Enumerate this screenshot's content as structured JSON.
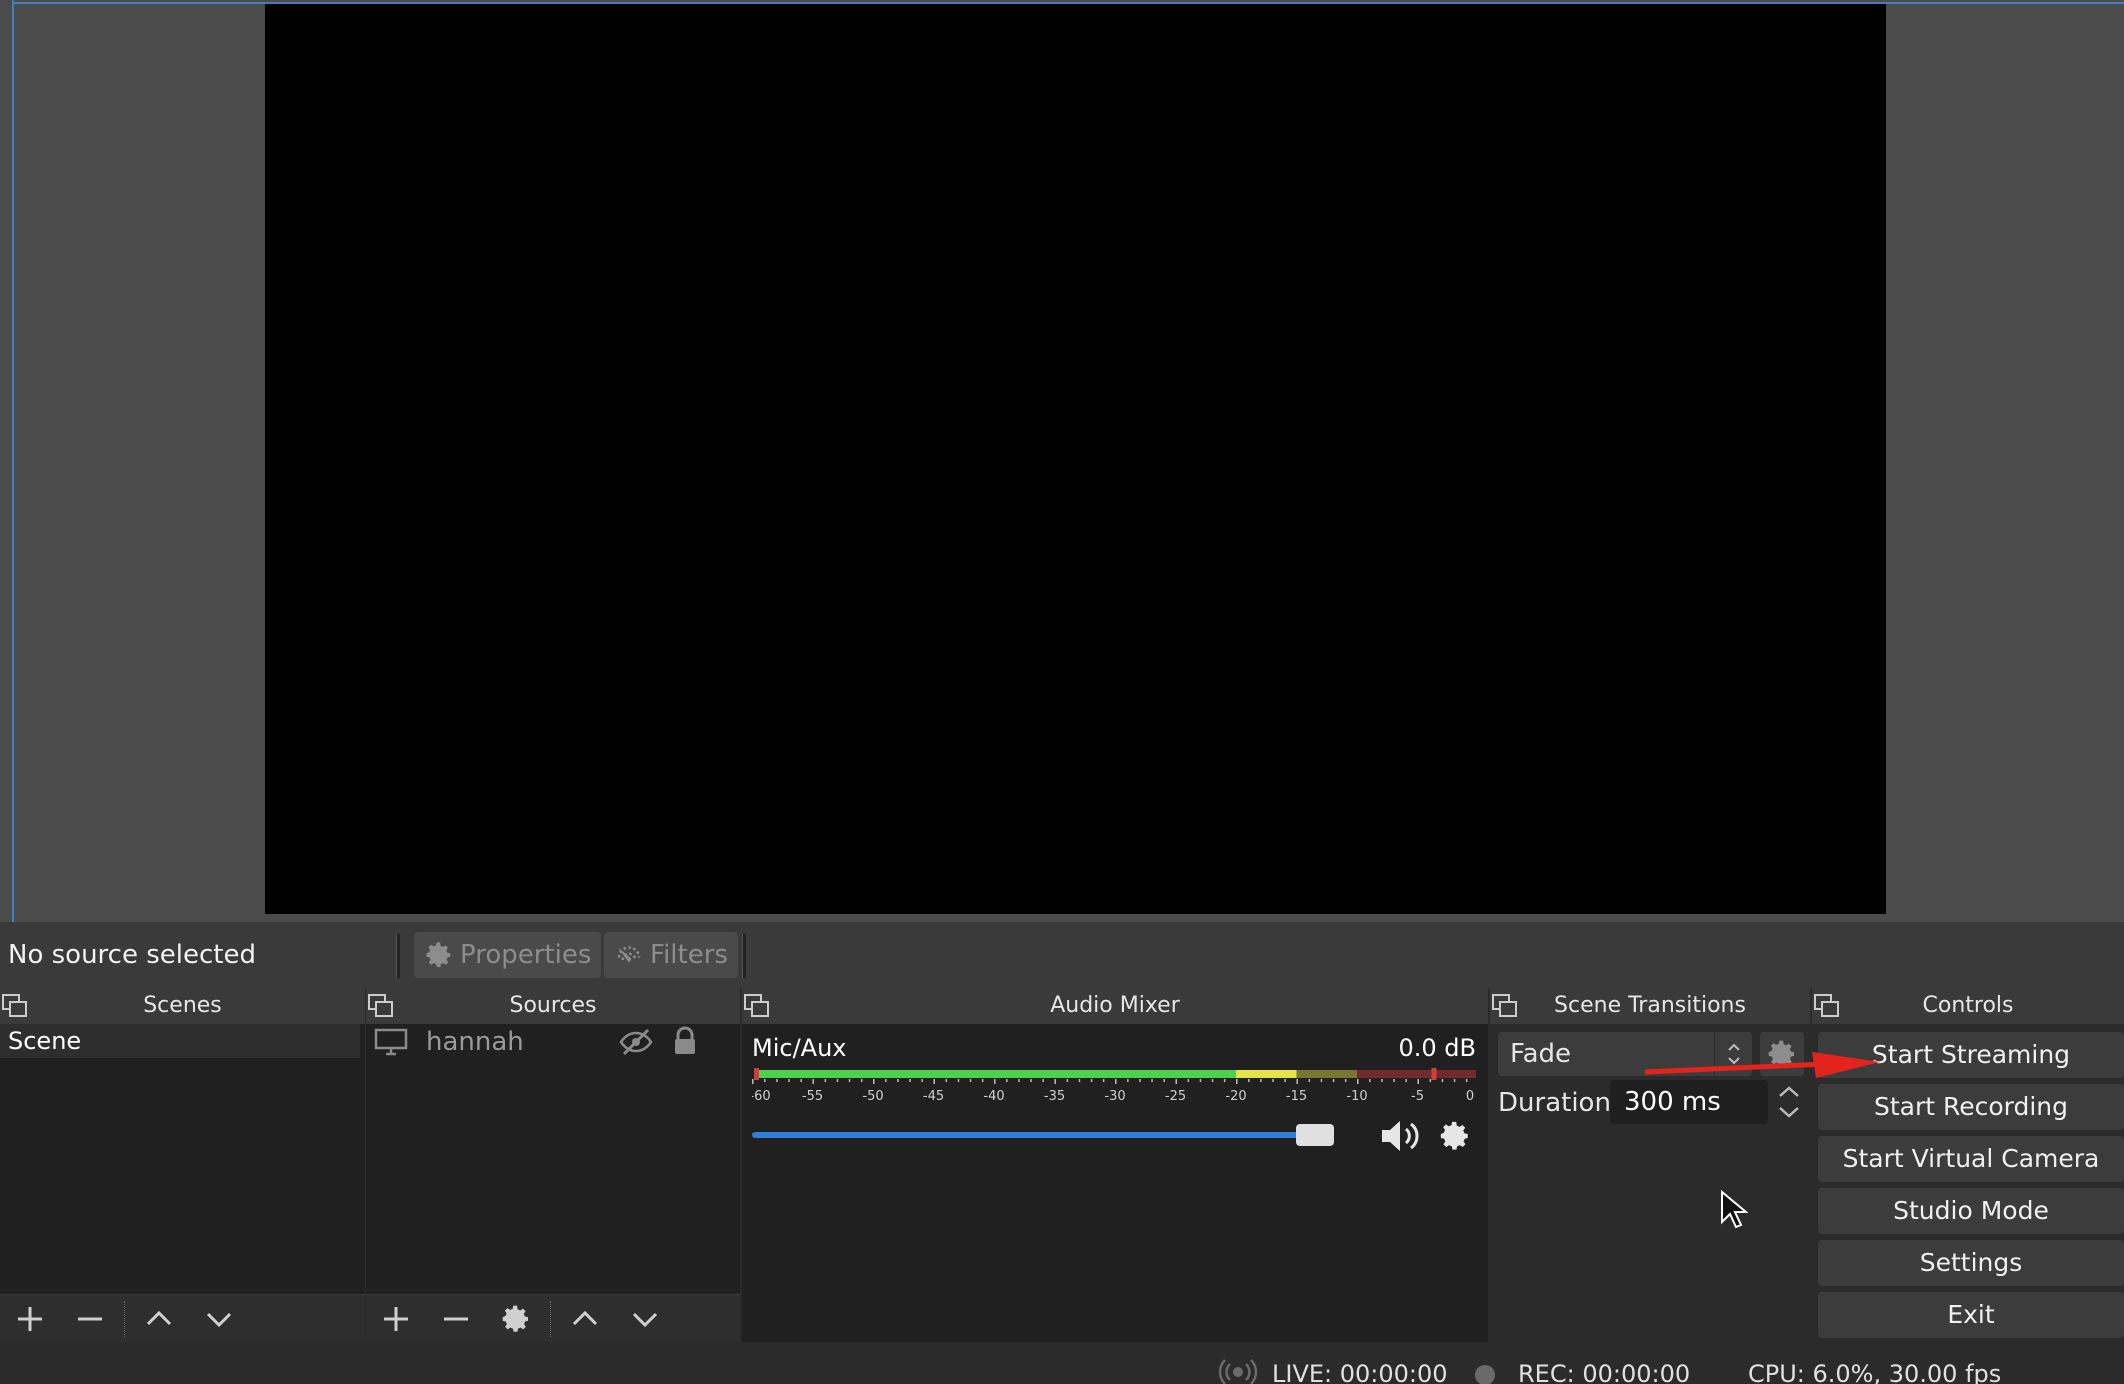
{
  "context_bar": {
    "selection_text": "No source selected",
    "properties_label": "Properties",
    "filters_label": "Filters"
  },
  "docks": {
    "scenes": "Scenes",
    "sources": "Sources",
    "mixer": "Audio Mixer",
    "transitions": "Scene Transitions",
    "controls": "Controls"
  },
  "scenes": {
    "items": [
      {
        "label": "Scene",
        "selected": true
      }
    ]
  },
  "sources": {
    "items": [
      {
        "label": "hannah",
        "icon": "display-icon",
        "visible": false,
        "locked": true
      }
    ]
  },
  "mixer": {
    "channel_label": "Mic/Aux",
    "level_db": "0.0 dB",
    "meter_ticks": [
      "-60",
      "-55",
      "-50",
      "-45",
      "-40",
      "-35",
      "-30",
      "-25",
      "-20",
      "-15",
      "-10",
      "-5",
      "0"
    ],
    "volume_fraction": 1.0,
    "colors": {
      "green": "#4cd24c",
      "yellow": "#e3e34a",
      "red": "#d23c3c",
      "volume": "#2f7ed8"
    }
  },
  "transitions": {
    "selected": "Fade",
    "duration_label": "Duration",
    "duration_value": "300 ms"
  },
  "controls": {
    "start_streaming": "Start Streaming",
    "start_recording": "Start Recording",
    "start_virtual_camera": "Start Virtual Camera",
    "studio_mode": "Studio Mode",
    "settings": "Settings",
    "exit": "Exit"
  },
  "status": {
    "live": "LIVE: 00:00:00",
    "rec": "REC: 00:00:00",
    "cpu": "CPU: 6.0%, 30.00 fps"
  },
  "annotation": {
    "color": "#e5231d"
  }
}
